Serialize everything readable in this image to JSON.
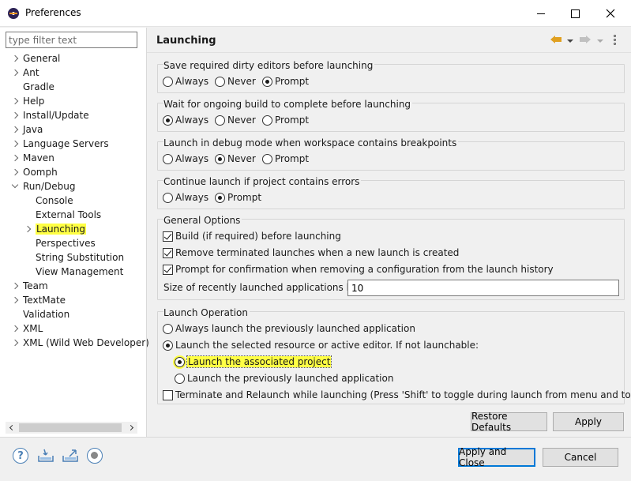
{
  "window": {
    "title": "Preferences"
  },
  "filter": {
    "placeholder": "type filter text"
  },
  "tree": [
    {
      "label": "General",
      "arrow": "right",
      "indent": 0
    },
    {
      "label": "Ant",
      "arrow": "right",
      "indent": 0
    },
    {
      "label": "Gradle",
      "arrow": "none",
      "indent": 0
    },
    {
      "label": "Help",
      "arrow": "right",
      "indent": 0
    },
    {
      "label": "Install/Update",
      "arrow": "right",
      "indent": 0
    },
    {
      "label": "Java",
      "arrow": "right",
      "indent": 0
    },
    {
      "label": "Language Servers",
      "arrow": "right",
      "indent": 0
    },
    {
      "label": "Maven",
      "arrow": "right",
      "indent": 0
    },
    {
      "label": "Oomph",
      "arrow": "right",
      "indent": 0
    },
    {
      "label": "Run/Debug",
      "arrow": "down",
      "indent": 0
    },
    {
      "label": "Console",
      "arrow": "none",
      "indent": 1
    },
    {
      "label": "External Tools",
      "arrow": "none",
      "indent": 1
    },
    {
      "label": "Launching",
      "arrow": "right",
      "indent": 1,
      "selected": true
    },
    {
      "label": "Perspectives",
      "arrow": "none",
      "indent": 1
    },
    {
      "label": "String Substitution",
      "arrow": "none",
      "indent": 1
    },
    {
      "label": "View Management",
      "arrow": "none",
      "indent": 1
    },
    {
      "label": "Team",
      "arrow": "right",
      "indent": 0
    },
    {
      "label": "TextMate",
      "arrow": "right",
      "indent": 0
    },
    {
      "label": "Validation",
      "arrow": "none",
      "indent": 0
    },
    {
      "label": "XML",
      "arrow": "right",
      "indent": 0
    },
    {
      "label": "XML (Wild Web Developer)",
      "arrow": "right",
      "indent": 0
    }
  ],
  "page": {
    "title": "Launching",
    "save_dirty": {
      "title": "Save required dirty editors before launching",
      "options": [
        "Always",
        "Never",
        "Prompt"
      ],
      "selected": "Prompt"
    },
    "wait_build": {
      "title": "Wait for ongoing build to complete before launching",
      "options": [
        "Always",
        "Never",
        "Prompt"
      ],
      "selected": "Always"
    },
    "debug_mode": {
      "title": "Launch in debug mode when workspace contains breakpoints",
      "options": [
        "Always",
        "Never",
        "Prompt"
      ],
      "selected": "Never"
    },
    "errors": {
      "title": "Continue launch if project contains errors",
      "options": [
        "Always",
        "Prompt"
      ],
      "selected": "Prompt"
    },
    "general": {
      "title": "General Options",
      "build": "Build (if required) before launching",
      "remove_terminated": "Remove terminated launches when a new launch is created",
      "prompt_confirm": "Prompt for confirmation when removing a configuration from the launch history",
      "size_label": "Size of recently launched applications list:",
      "size_value": "10"
    },
    "launch_op": {
      "title": "Launch Operation",
      "always_previous": "Always launch the previously launched application",
      "launch_selected": "Launch the selected resource or active editor. If not launchable:",
      "launch_associated": "Launch the associated project",
      "launch_previous": "Launch the previously launched application",
      "terminate_relaunch": "Terminate and Relaunch while launching (Press 'Shift' to toggle during launch from menu and toolbar)"
    }
  },
  "buttons": {
    "restore": "Restore Defaults",
    "apply": "Apply",
    "apply_close": "Apply and Close",
    "cancel": "Cancel"
  },
  "icons": {
    "help": "?"
  }
}
